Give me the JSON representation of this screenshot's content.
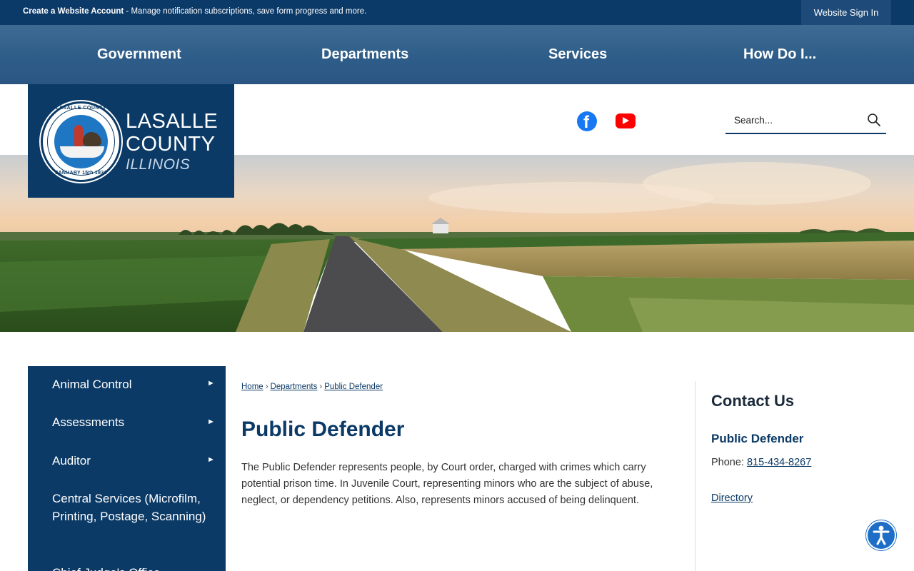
{
  "topbar": {
    "account_strong": "Create a Website Account",
    "account_rest": " - Manage notification subscriptions, save form progress and more.",
    "signin_label": "Website Sign In"
  },
  "mainnav": {
    "items": [
      "Government",
      "Departments",
      "Services",
      "How Do I..."
    ]
  },
  "logo": {
    "line1": "LASALLE",
    "line2": "COUNTY",
    "line3": "ILLINOIS",
    "seal_top": "LASALLE COUNTY",
    "seal_bottom": "JANUARY 15th 1831"
  },
  "social": {
    "facebook_icon": "facebook-icon",
    "youtube_icon": "youtube-icon"
  },
  "search": {
    "placeholder": "Search..."
  },
  "sidenav": {
    "items": [
      "Animal Control",
      "Assessments",
      "Auditor",
      "Central Services (Microfilm, Printing, Postage, Scanning)",
      "Chief Judge's Office"
    ]
  },
  "breadcrumb": {
    "items": [
      "Home",
      "Departments",
      "Public Defender"
    ],
    "separator": "›"
  },
  "main": {
    "title": "Public Defender",
    "body": "The Public Defender represents people, by Court order, charged with crimes which carry potential prison time. In Juvenile Court, representing minors who are the subject of abuse, neglect, or dependency petitions. Also, represents minors accused of being delinquent."
  },
  "contact": {
    "title": "Contact Us",
    "name": "Public Defender",
    "phone_label": "Phone: ",
    "phone": "815-434-8267",
    "directory": "Directory"
  },
  "colors": {
    "brand_navy": "#0b3a66",
    "topbar": "#0c3a68",
    "nav_blue": "#2e5d89"
  }
}
